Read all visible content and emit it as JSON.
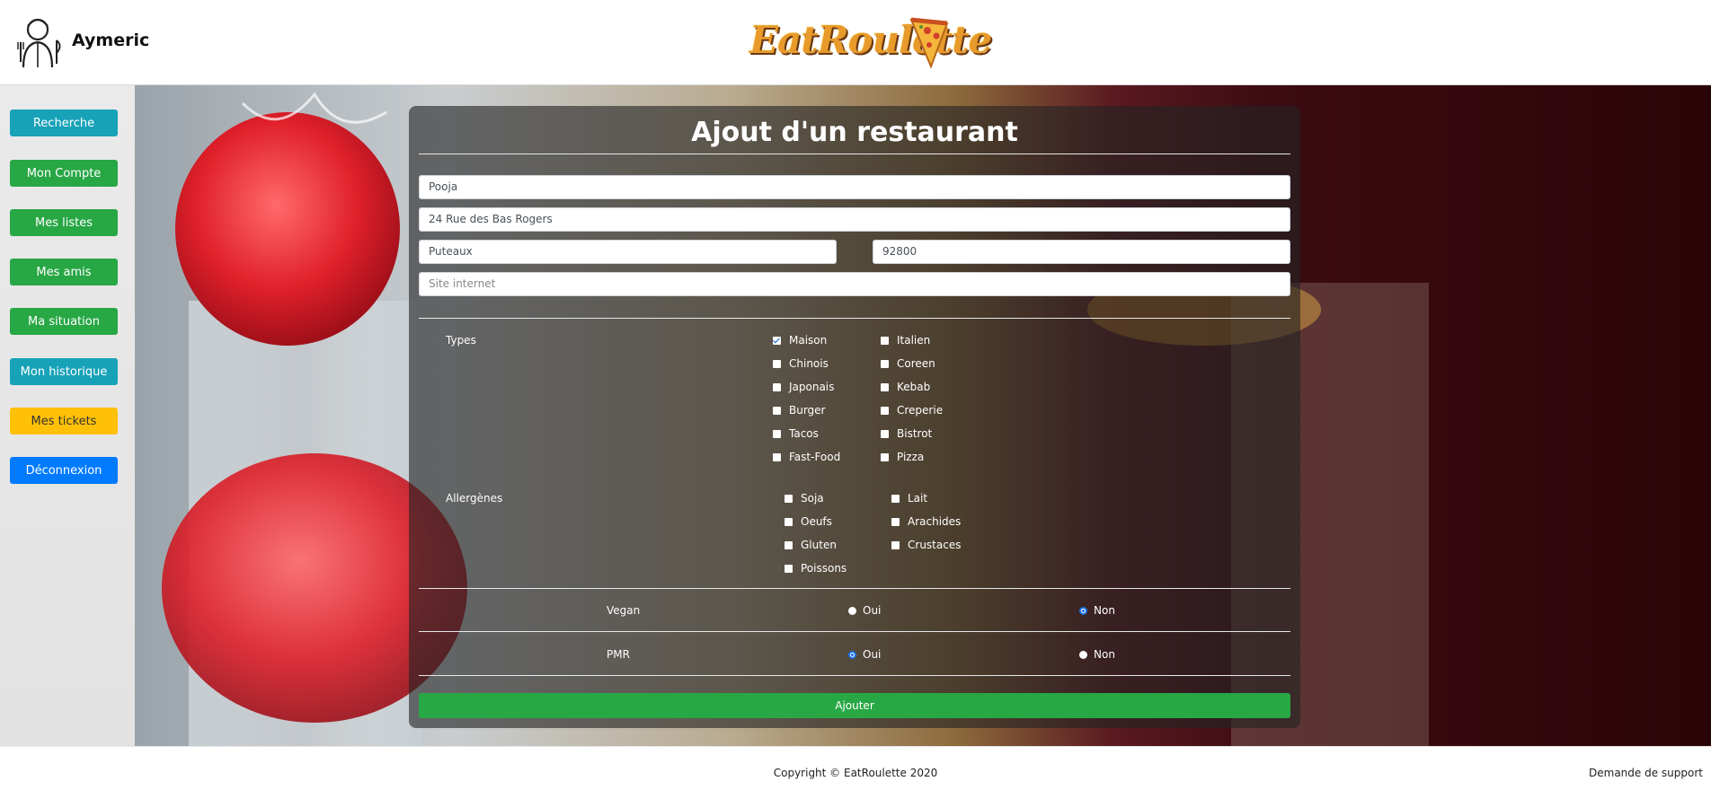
{
  "header": {
    "username": "Aymeric",
    "logo_text": "EatRoulette"
  },
  "sidebar": {
    "items": [
      {
        "label": "Recherche",
        "color": "#17a2b8"
      },
      {
        "label": "Mon Compte",
        "color": "#28a745"
      },
      {
        "label": "Mes listes",
        "color": "#28a745"
      },
      {
        "label": "Mes amis",
        "color": "#28a745"
      },
      {
        "label": "Ma situation",
        "color": "#28a745"
      },
      {
        "label": "Mon historique",
        "color": "#17a2b8"
      },
      {
        "label": "Mes tickets",
        "color": "#ffc107"
      },
      {
        "label": "Déconnexion",
        "color": "#007bff"
      }
    ]
  },
  "form": {
    "title": "Ajout d'un restaurant",
    "name": "Pooja",
    "address": "24 Rue des Bas Rogers",
    "city": "Puteaux",
    "postal_code": "92800",
    "website_placeholder": "Site internet",
    "types_label": "Types",
    "types": [
      {
        "label": "Maison",
        "checked": true
      },
      {
        "label": "Italien",
        "checked": false
      },
      {
        "label": "Chinois",
        "checked": false
      },
      {
        "label": "Coreen",
        "checked": false
      },
      {
        "label": "Japonais",
        "checked": false
      },
      {
        "label": "Kebab",
        "checked": false
      },
      {
        "label": "Burger",
        "checked": false
      },
      {
        "label": "Creperie",
        "checked": false
      },
      {
        "label": "Tacos",
        "checked": false
      },
      {
        "label": "Bistrot",
        "checked": false
      },
      {
        "label": "Fast-Food",
        "checked": false
      },
      {
        "label": "Pizza",
        "checked": false
      }
    ],
    "allergens_label": "Allergènes",
    "allergens": [
      {
        "label": "Soja",
        "checked": false
      },
      {
        "label": "Lait",
        "checked": false
      },
      {
        "label": "Oeufs",
        "checked": false
      },
      {
        "label": "Arachides",
        "checked": false
      },
      {
        "label": "Gluten",
        "checked": false
      },
      {
        "label": "Crustaces",
        "checked": false
      },
      {
        "label": "Poissons",
        "checked": false
      }
    ],
    "vegan": {
      "label": "Vegan",
      "yes": "Oui",
      "no": "Non",
      "selected": "Non"
    },
    "pmr": {
      "label": "PMR",
      "yes": "Oui",
      "no": "Non",
      "selected": "Oui"
    },
    "submit_label": "Ajouter"
  },
  "footer": {
    "copyright": "Copyright © EatRoulette 2020",
    "support": "Demande de support"
  }
}
